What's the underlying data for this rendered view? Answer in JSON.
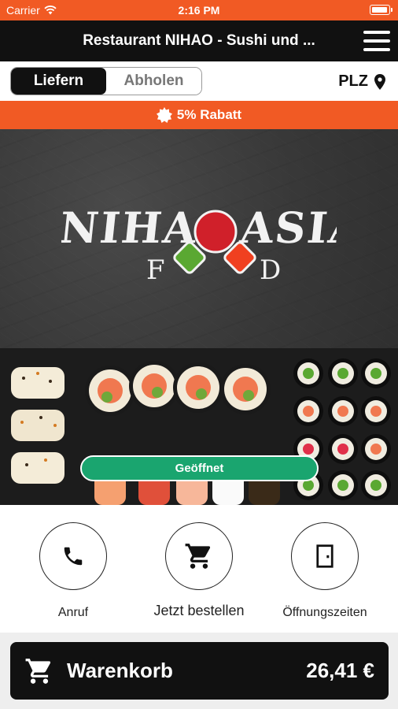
{
  "status_bar": {
    "carrier": "Carrier",
    "time": "2:16 PM"
  },
  "header": {
    "title": "Restaurant NIHAO - Sushi und ...",
    "menu_icon": "hamburger-menu-icon"
  },
  "delivery_mode": {
    "options": [
      "Liefern",
      "Abholen"
    ],
    "selected": "Liefern",
    "plz_label": "PLZ"
  },
  "promo": {
    "text": "5% Rabatt"
  },
  "hero": {
    "status_pill": "Geöffnet"
  },
  "logo": {
    "line1_left": "NIHAO",
    "line1_right": "ASIA",
    "line2": [
      "F",
      "D"
    ]
  },
  "actions": [
    {
      "label": "Anruf",
      "icon": "phone-icon"
    },
    {
      "label": "Jetzt bestellen",
      "icon": "cart-icon"
    },
    {
      "label": "Öffnungszeiten",
      "icon": "door-icon"
    }
  ],
  "cart": {
    "label": "Warenkorb",
    "total": "26,41 €"
  },
  "colors": {
    "accent": "#f15a24",
    "dark": "#111111",
    "open": "#1aa56f"
  }
}
